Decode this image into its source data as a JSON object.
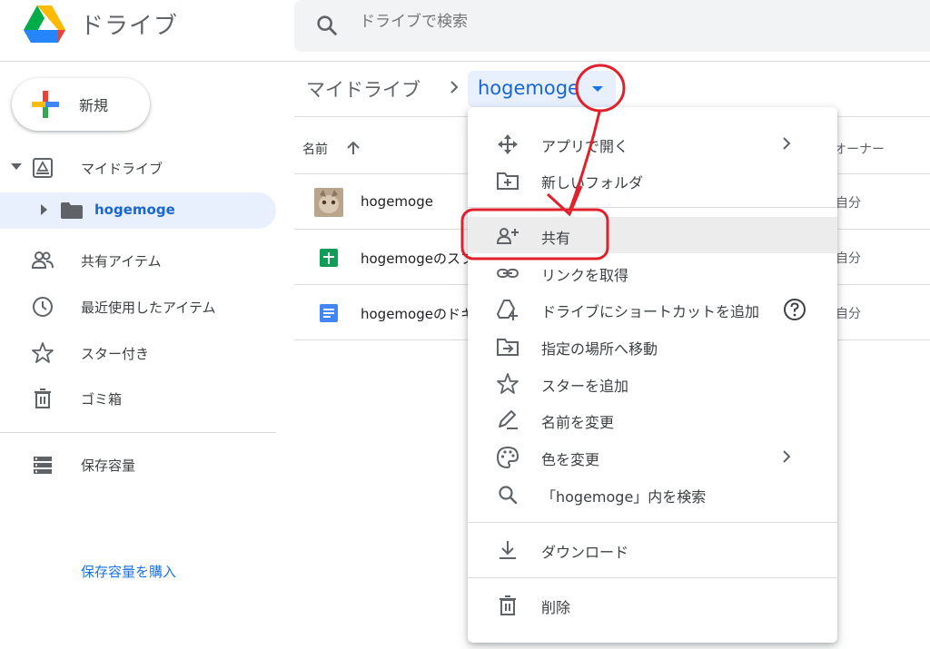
{
  "header": {
    "app_title": "ドライブ",
    "search_placeholder": "ドライブで検索"
  },
  "sidebar": {
    "new_label": "新規",
    "items": [
      {
        "label": "マイドライブ"
      },
      {
        "label": "hogemoge"
      },
      {
        "label": "共有アイテム"
      },
      {
        "label": "最近使用したアイテム"
      },
      {
        "label": "スター付き"
      },
      {
        "label": "ゴミ箱"
      },
      {
        "label": "保存容量"
      }
    ],
    "buy_storage": "保存容量を購入"
  },
  "breadcrumb": {
    "root": "マイドライブ",
    "current": "hogemoge"
  },
  "table": {
    "col_name": "名前",
    "col_owner": "オーナー",
    "rows": [
      {
        "name": "hogemoge",
        "owner": "自分",
        "type": "image"
      },
      {
        "name": "hogemogeのスプレッドシート",
        "owner": "自分",
        "type": "sheet"
      },
      {
        "name": "hogemogeのドキュメント",
        "owner": "自分",
        "type": "doc"
      }
    ]
  },
  "menu": {
    "items": [
      {
        "label": "アプリで開く",
        "icon": "open-with-icon"
      },
      {
        "label": "新しいフォルダ",
        "icon": "new-folder-icon"
      },
      {
        "label": "共有",
        "icon": "share-person-add-icon"
      },
      {
        "label": "リンクを取得",
        "icon": "link-icon"
      },
      {
        "label": "ドライブにショートカットを追加",
        "icon": "add-shortcut-icon"
      },
      {
        "label": "指定の場所へ移動",
        "icon": "move-to-folder-icon"
      },
      {
        "label": "スターを追加",
        "icon": "star-outline-icon"
      },
      {
        "label": "名前を変更",
        "icon": "rename-icon"
      },
      {
        "label": "色を変更",
        "icon": "palette-icon"
      },
      {
        "label": "「hogemoge」内を検索",
        "icon": "search-icon"
      },
      {
        "label": "ダウンロード",
        "icon": "download-icon"
      },
      {
        "label": "削除",
        "icon": "trash-icon"
      }
    ]
  },
  "colors": {
    "accent_blue": "#1a73e8",
    "selected_bg": "#e8f0fe",
    "annotation_red": "#e0202a"
  }
}
